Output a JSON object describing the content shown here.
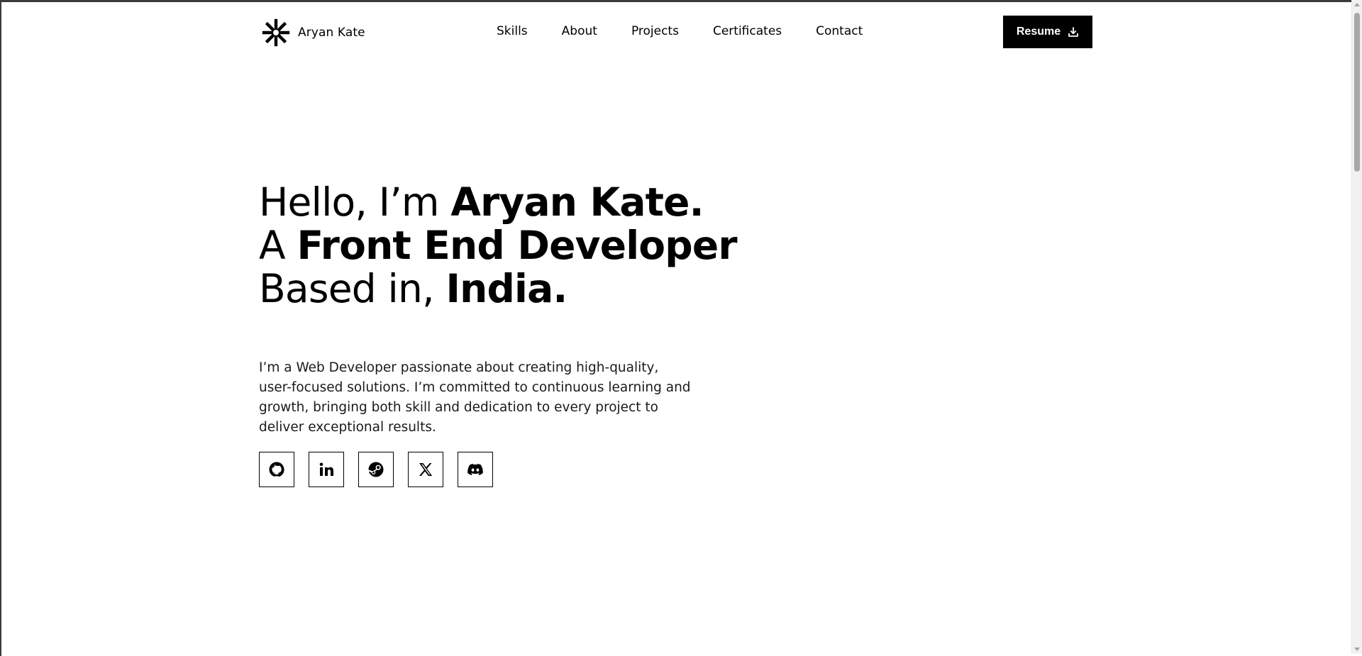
{
  "header": {
    "brand_name": "Aryan Kate",
    "brand_icon": "asterisk-logo-icon",
    "nav": [
      {
        "label": "Skills"
      },
      {
        "label": "About"
      },
      {
        "label": "Projects"
      },
      {
        "label": "Certificates"
      },
      {
        "label": "Contact"
      }
    ],
    "resume_label": "Resume",
    "resume_icon": "download-icon"
  },
  "hero": {
    "line1_light": "Hello, I’m ",
    "line1_bold": "Aryan Kate.",
    "line2_light": "A ",
    "line2_bold": "Front End Developer",
    "line3_light": "Based in, ",
    "line3_bold": "India.",
    "intro": "I’m a Web Developer passionate about creating high-quality, user-focused solutions. I’m committed to continuous learning and growth, bringing both skill and dedication to every project to deliver exceptional results."
  },
  "socials": [
    {
      "icon": "github-icon"
    },
    {
      "icon": "linkedin-icon"
    },
    {
      "icon": "steam-icon"
    },
    {
      "icon": "x-twitter-icon"
    },
    {
      "icon": "discord-icon"
    }
  ],
  "colors": {
    "accent": "#000000",
    "background": "#ffffff",
    "text": "#1a1a1a"
  }
}
